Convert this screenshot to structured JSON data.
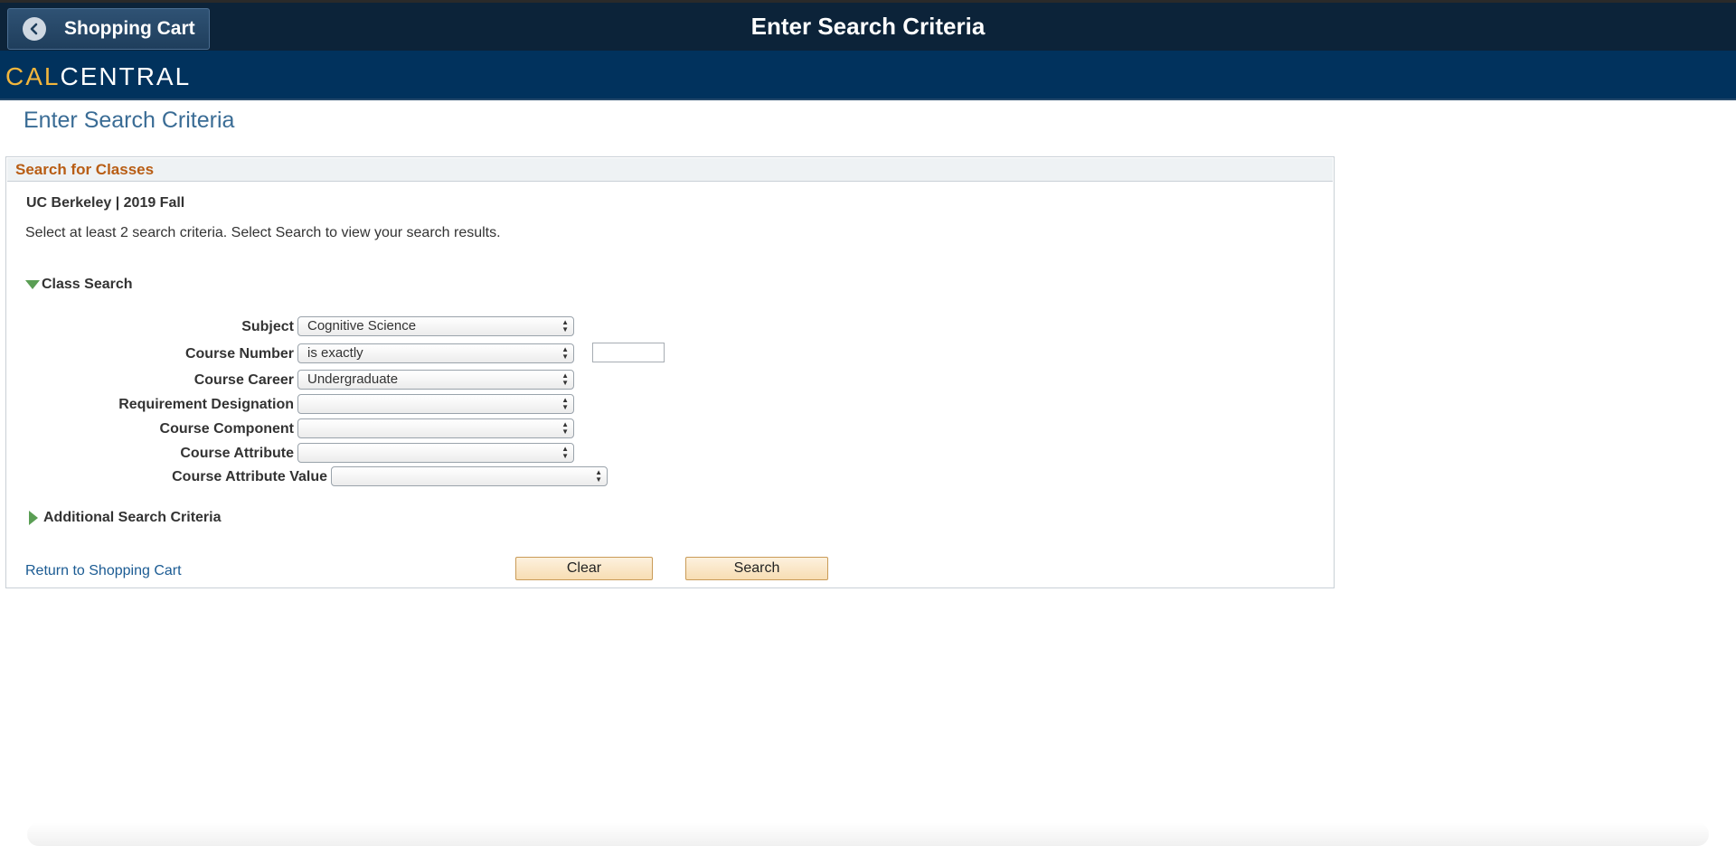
{
  "topbar": {
    "back_label": "Shopping Cart",
    "title": "Enter Search Criteria"
  },
  "brand": {
    "cal": "CAL",
    "central": "CENTRAL",
    "cal_color": "#f2b63c"
  },
  "page": {
    "title": "Enter Search Criteria"
  },
  "panel": {
    "header": "Search for Classes",
    "term": "UC Berkeley | 2019 Fall",
    "instructions": "Select at least 2 search criteria. Select Search to view your search results.",
    "class_search_label": "Class Search",
    "additional_label": "Additional Search Criteria",
    "fields": {
      "subject": {
        "label": "Subject",
        "value": "Cognitive Science"
      },
      "course_number": {
        "label": "Course Number",
        "operator": "is exactly",
        "value": ""
      },
      "course_career": {
        "label": "Course Career",
        "value": "Undergraduate"
      },
      "requirement_designation": {
        "label": "Requirement Designation",
        "value": ""
      },
      "course_component": {
        "label": "Course Component",
        "value": ""
      },
      "course_attribute": {
        "label": "Course Attribute",
        "value": ""
      },
      "course_attribute_value": {
        "label": "Course Attribute Value",
        "value": ""
      }
    },
    "return_link": "Return to Shopping Cart",
    "clear_label": "Clear",
    "search_label": "Search"
  },
  "colors": {
    "topbar": "#0c2339",
    "brandbar": "#01325d",
    "section_header_text": "#b85d14",
    "button_bg": "#f7ddb3"
  }
}
